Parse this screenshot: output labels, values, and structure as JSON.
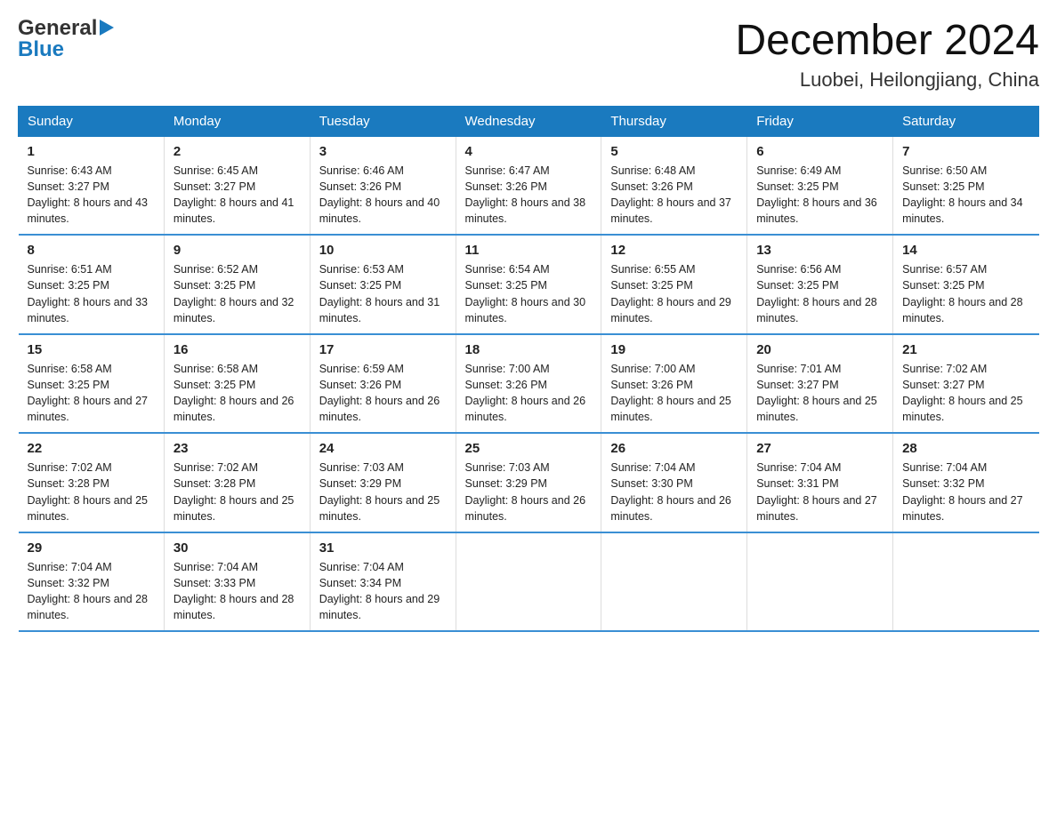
{
  "header": {
    "logo_line1": "General",
    "logo_line2": "Blue",
    "month_title": "December 2024",
    "location": "Luobei, Heilongjiang, China"
  },
  "weekdays": [
    "Sunday",
    "Monday",
    "Tuesday",
    "Wednesday",
    "Thursday",
    "Friday",
    "Saturday"
  ],
  "weeks": [
    [
      {
        "day": "1",
        "sunrise": "Sunrise: 6:43 AM",
        "sunset": "Sunset: 3:27 PM",
        "daylight": "Daylight: 8 hours and 43 minutes."
      },
      {
        "day": "2",
        "sunrise": "Sunrise: 6:45 AM",
        "sunset": "Sunset: 3:27 PM",
        "daylight": "Daylight: 8 hours and 41 minutes."
      },
      {
        "day": "3",
        "sunrise": "Sunrise: 6:46 AM",
        "sunset": "Sunset: 3:26 PM",
        "daylight": "Daylight: 8 hours and 40 minutes."
      },
      {
        "day": "4",
        "sunrise": "Sunrise: 6:47 AM",
        "sunset": "Sunset: 3:26 PM",
        "daylight": "Daylight: 8 hours and 38 minutes."
      },
      {
        "day": "5",
        "sunrise": "Sunrise: 6:48 AM",
        "sunset": "Sunset: 3:26 PM",
        "daylight": "Daylight: 8 hours and 37 minutes."
      },
      {
        "day": "6",
        "sunrise": "Sunrise: 6:49 AM",
        "sunset": "Sunset: 3:25 PM",
        "daylight": "Daylight: 8 hours and 36 minutes."
      },
      {
        "day": "7",
        "sunrise": "Sunrise: 6:50 AM",
        "sunset": "Sunset: 3:25 PM",
        "daylight": "Daylight: 8 hours and 34 minutes."
      }
    ],
    [
      {
        "day": "8",
        "sunrise": "Sunrise: 6:51 AM",
        "sunset": "Sunset: 3:25 PM",
        "daylight": "Daylight: 8 hours and 33 minutes."
      },
      {
        "day": "9",
        "sunrise": "Sunrise: 6:52 AM",
        "sunset": "Sunset: 3:25 PM",
        "daylight": "Daylight: 8 hours and 32 minutes."
      },
      {
        "day": "10",
        "sunrise": "Sunrise: 6:53 AM",
        "sunset": "Sunset: 3:25 PM",
        "daylight": "Daylight: 8 hours and 31 minutes."
      },
      {
        "day": "11",
        "sunrise": "Sunrise: 6:54 AM",
        "sunset": "Sunset: 3:25 PM",
        "daylight": "Daylight: 8 hours and 30 minutes."
      },
      {
        "day": "12",
        "sunrise": "Sunrise: 6:55 AM",
        "sunset": "Sunset: 3:25 PM",
        "daylight": "Daylight: 8 hours and 29 minutes."
      },
      {
        "day": "13",
        "sunrise": "Sunrise: 6:56 AM",
        "sunset": "Sunset: 3:25 PM",
        "daylight": "Daylight: 8 hours and 28 minutes."
      },
      {
        "day": "14",
        "sunrise": "Sunrise: 6:57 AM",
        "sunset": "Sunset: 3:25 PM",
        "daylight": "Daylight: 8 hours and 28 minutes."
      }
    ],
    [
      {
        "day": "15",
        "sunrise": "Sunrise: 6:58 AM",
        "sunset": "Sunset: 3:25 PM",
        "daylight": "Daylight: 8 hours and 27 minutes."
      },
      {
        "day": "16",
        "sunrise": "Sunrise: 6:58 AM",
        "sunset": "Sunset: 3:25 PM",
        "daylight": "Daylight: 8 hours and 26 minutes."
      },
      {
        "day": "17",
        "sunrise": "Sunrise: 6:59 AM",
        "sunset": "Sunset: 3:26 PM",
        "daylight": "Daylight: 8 hours and 26 minutes."
      },
      {
        "day": "18",
        "sunrise": "Sunrise: 7:00 AM",
        "sunset": "Sunset: 3:26 PM",
        "daylight": "Daylight: 8 hours and 26 minutes."
      },
      {
        "day": "19",
        "sunrise": "Sunrise: 7:00 AM",
        "sunset": "Sunset: 3:26 PM",
        "daylight": "Daylight: 8 hours and 25 minutes."
      },
      {
        "day": "20",
        "sunrise": "Sunrise: 7:01 AM",
        "sunset": "Sunset: 3:27 PM",
        "daylight": "Daylight: 8 hours and 25 minutes."
      },
      {
        "day": "21",
        "sunrise": "Sunrise: 7:02 AM",
        "sunset": "Sunset: 3:27 PM",
        "daylight": "Daylight: 8 hours and 25 minutes."
      }
    ],
    [
      {
        "day": "22",
        "sunrise": "Sunrise: 7:02 AM",
        "sunset": "Sunset: 3:28 PM",
        "daylight": "Daylight: 8 hours and 25 minutes."
      },
      {
        "day": "23",
        "sunrise": "Sunrise: 7:02 AM",
        "sunset": "Sunset: 3:28 PM",
        "daylight": "Daylight: 8 hours and 25 minutes."
      },
      {
        "day": "24",
        "sunrise": "Sunrise: 7:03 AM",
        "sunset": "Sunset: 3:29 PM",
        "daylight": "Daylight: 8 hours and 25 minutes."
      },
      {
        "day": "25",
        "sunrise": "Sunrise: 7:03 AM",
        "sunset": "Sunset: 3:29 PM",
        "daylight": "Daylight: 8 hours and 26 minutes."
      },
      {
        "day": "26",
        "sunrise": "Sunrise: 7:04 AM",
        "sunset": "Sunset: 3:30 PM",
        "daylight": "Daylight: 8 hours and 26 minutes."
      },
      {
        "day": "27",
        "sunrise": "Sunrise: 7:04 AM",
        "sunset": "Sunset: 3:31 PM",
        "daylight": "Daylight: 8 hours and 27 minutes."
      },
      {
        "day": "28",
        "sunrise": "Sunrise: 7:04 AM",
        "sunset": "Sunset: 3:32 PM",
        "daylight": "Daylight: 8 hours and 27 minutes."
      }
    ],
    [
      {
        "day": "29",
        "sunrise": "Sunrise: 7:04 AM",
        "sunset": "Sunset: 3:32 PM",
        "daylight": "Daylight: 8 hours and 28 minutes."
      },
      {
        "day": "30",
        "sunrise": "Sunrise: 7:04 AM",
        "sunset": "Sunset: 3:33 PM",
        "daylight": "Daylight: 8 hours and 28 minutes."
      },
      {
        "day": "31",
        "sunrise": "Sunrise: 7:04 AM",
        "sunset": "Sunset: 3:34 PM",
        "daylight": "Daylight: 8 hours and 29 minutes."
      },
      null,
      null,
      null,
      null
    ]
  ]
}
